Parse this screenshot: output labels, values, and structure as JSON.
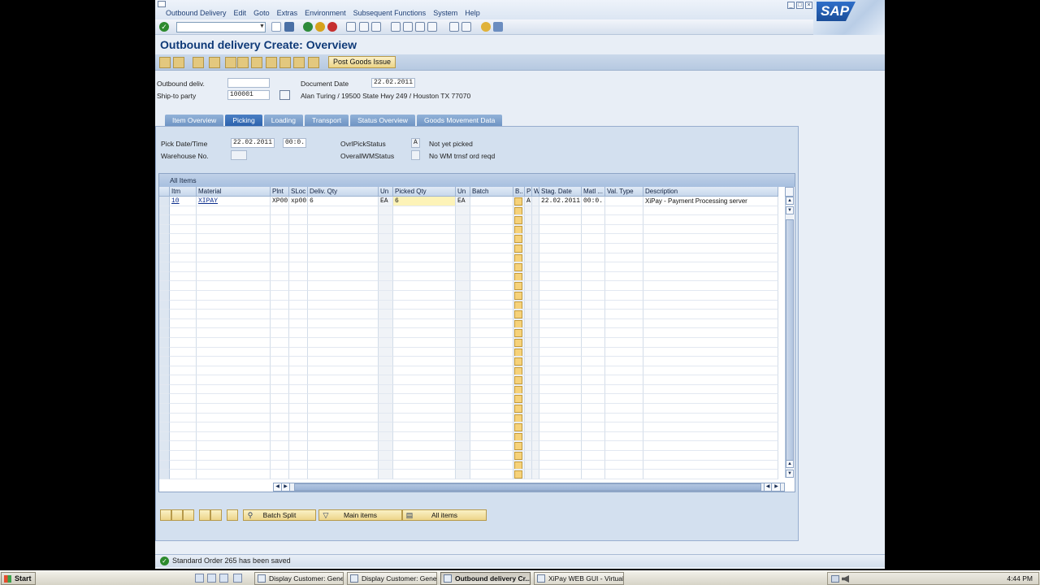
{
  "menu": [
    "Outbound Delivery",
    "Edit",
    "Goto",
    "Extras",
    "Environment",
    "Subsequent Functions",
    "System",
    "Help"
  ],
  "logo": "SAP",
  "title": "Outbound delivery  Create: Overview",
  "app_toolbar": {
    "post_goods_issue": "Post Goods Issue"
  },
  "header": {
    "outbound_deliv_label": "Outbound deliv.",
    "outbound_deliv_value": "",
    "ship_to_label": "Ship-to party",
    "ship_to_value": "100001",
    "doc_date_label": "Document Date",
    "doc_date_value": "22.02.2011",
    "ship_to_address": "Alan Turing / 19500 State Hwy 249 / Houston TX 77070"
  },
  "tabs": [
    {
      "label": "Item Overview",
      "active": false
    },
    {
      "label": "Picking",
      "active": true
    },
    {
      "label": "Loading",
      "active": false
    },
    {
      "label": "Transport",
      "active": false
    },
    {
      "label": "Status Overview",
      "active": false
    },
    {
      "label": "Goods Movement Data",
      "active": false
    }
  ],
  "picking": {
    "pick_date_label": "Pick Date/Time",
    "pick_date_value": "22.02.2011",
    "pick_time_value": "00:0.",
    "warehouse_label": "Warehouse No.",
    "ovrl_pick_label": "OvrlPickStatus",
    "ovrl_pick_value": "A",
    "ovrl_pick_text": "Not yet picked",
    "overall_wm_label": "OverallWMStatus",
    "overall_wm_text": "No WM trnsf ord reqd"
  },
  "table": {
    "title": "All Items",
    "columns": [
      "Itm",
      "Material",
      "Plnt",
      "SLoc",
      "Deliv. Qty",
      "Un",
      "Picked Qty",
      "Un",
      "Batch",
      "B..",
      "P",
      "W",
      "Stag. Date",
      "Matl ...",
      "Val. Type",
      "Description"
    ],
    "rows": [
      [
        "10",
        "XIPAY",
        "XP00",
        "xp00",
        "6",
        "EA",
        "6",
        "EA",
        "",
        "",
        "A",
        "",
        "22.02.2011",
        "00:0..",
        "",
        "XiPay - Payment Processing server"
      ]
    ]
  },
  "bottom_buttons": {
    "batch_split": "Batch Split",
    "main_items": "Main items",
    "all_items": "All items"
  },
  "status": {
    "message": "Standard Order 265 has been saved"
  },
  "taskbar": {
    "start": "Start",
    "tasks": [
      {
        "label": "Display Customer: Gener...",
        "active": false
      },
      {
        "label": "Display Customer: Gener...",
        "active": false
      },
      {
        "label": "Outbound delivery  Cr...",
        "active": true
      },
      {
        "label": "XiPay WEB GUI - Virtual ...",
        "active": false
      }
    ],
    "clock": "4:44 PM"
  }
}
